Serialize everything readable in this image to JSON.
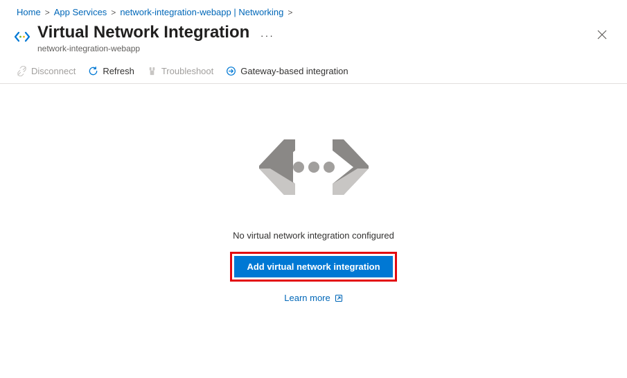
{
  "breadcrumb": {
    "home": "Home",
    "app_services": "App Services",
    "networking": "network-integration-webapp | Networking"
  },
  "header": {
    "title": "Virtual Network Integration",
    "subtitle": "network-integration-webapp"
  },
  "toolbar": {
    "disconnect": "Disconnect",
    "refresh": "Refresh",
    "troubleshoot": "Troubleshoot",
    "gateway": "Gateway-based integration"
  },
  "content": {
    "message": "No virtual network integration configured",
    "add_button": "Add virtual network integration",
    "learn_more": "Learn more"
  }
}
